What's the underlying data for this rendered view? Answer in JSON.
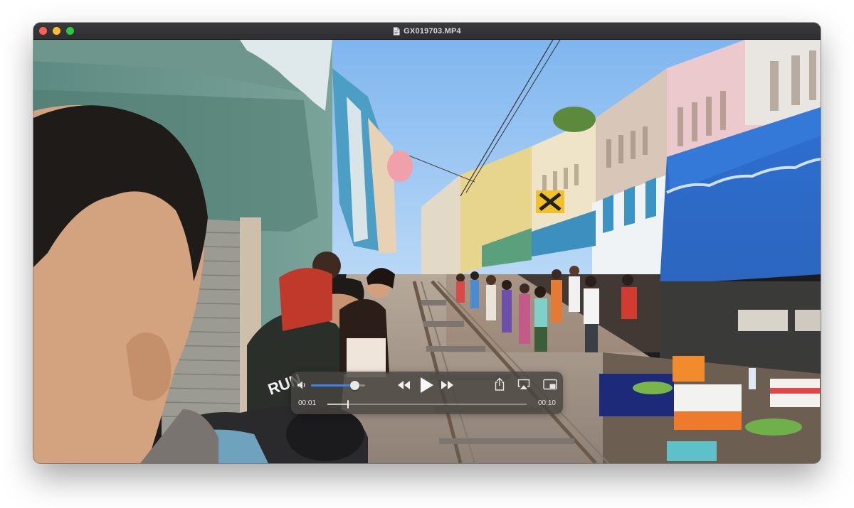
{
  "window": {
    "title": "GX019703.MP4",
    "title_icon": "document-icon"
  },
  "player": {
    "current_time": "00:01",
    "duration": "00:10",
    "progress": 0.1,
    "volume": 0.8,
    "controls": {
      "volume": "speaker-icon",
      "rewind": "rewind-icon",
      "play": "play-icon",
      "fast_forward": "fast-forward-icon",
      "share": "share-icon",
      "airplay": "airplay-icon",
      "picture_in_picture": "pip-icon"
    }
  },
  "video_frame": {
    "shirt_text": "RUN"
  },
  "colors": {
    "accent": "#3a82f7",
    "close": "#ff5f57",
    "minimize": "#febc2e",
    "zoom": "#28c840"
  }
}
